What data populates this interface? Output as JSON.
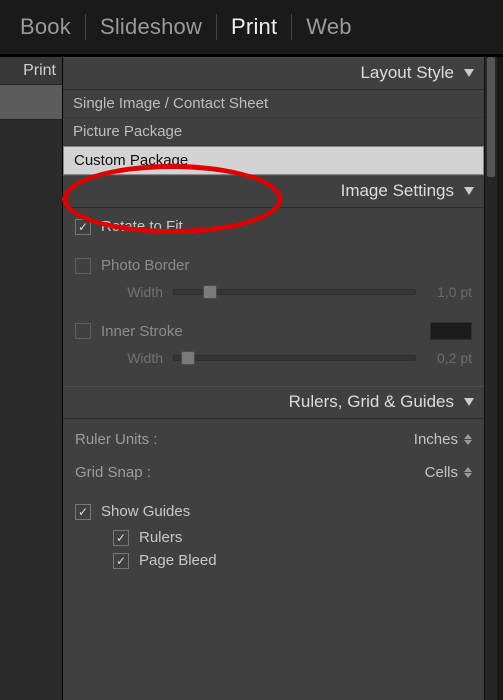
{
  "header": {
    "tabs": [
      "Book",
      "Slideshow",
      "Print",
      "Web"
    ],
    "active_index": 2
  },
  "left_panel": {
    "title": "Print"
  },
  "panels": {
    "layout_style": {
      "title": "Layout Style",
      "items": [
        "Single Image / Contact Sheet",
        "Picture Package",
        "Custom Package"
      ],
      "selected_index": 2
    },
    "image_settings": {
      "title": "Image Settings",
      "rotate": {
        "label": "Rotate to Fit",
        "checked": true
      },
      "photo_border": {
        "label": "Photo Border",
        "checked": false,
        "width_label": "Width",
        "value": "1,0 pt",
        "knob_pct": 12
      },
      "inner_stroke": {
        "label": "Inner Stroke",
        "checked": false,
        "width_label": "Width",
        "value": "0,2 pt",
        "knob_pct": 3,
        "color": "#000000"
      }
    },
    "guides": {
      "title": "Rulers, Grid & Guides",
      "ruler_units": {
        "label": "Ruler Units :",
        "value": "Inches"
      },
      "grid_snap": {
        "label": "Grid Snap :",
        "value": "Cells"
      },
      "show_guides": {
        "label": "Show Guides",
        "checked": true,
        "children": [
          {
            "label": "Rulers",
            "checked": true
          },
          {
            "label": "Page Bleed",
            "checked": true
          }
        ]
      }
    }
  }
}
